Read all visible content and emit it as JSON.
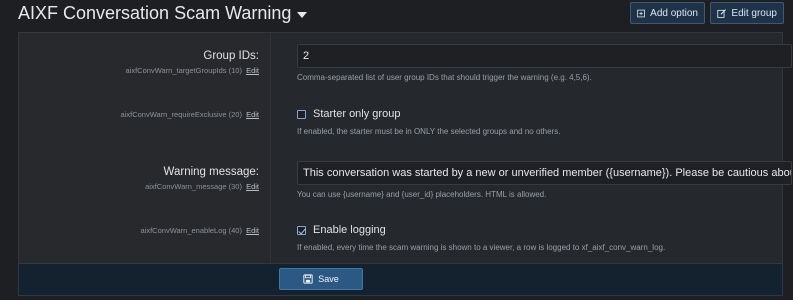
{
  "header": {
    "title": "AIXF Conversation Scam Warning",
    "add_option_label": "Add option",
    "edit_group_label": "Edit group"
  },
  "options": {
    "group_ids": {
      "label": "Group IDs:",
      "id": "aixfConvWarn_targetGroupIds (10)",
      "edit": "Edit",
      "value": "2",
      "explain": "Comma-separated list of user group IDs that should trigger the warning (e.g. 4,5,6)."
    },
    "require_exclusive": {
      "id": "aixfConvWarn_requireExclusive (20)",
      "edit": "Edit",
      "checkbox_label": "Starter only group",
      "checked": false,
      "explain": "If enabled, the starter must be in ONLY the selected groups and no others."
    },
    "message": {
      "label": "Warning message:",
      "id": "aixfConvWarn_message (30)",
      "edit": "Edit",
      "value": "This conversation was started by a new or unverified member ({username}). Please be cautious about sca",
      "explain": "You can use {username} and {user_id} placeholders. HTML is allowed."
    },
    "enable_log": {
      "id": "aixfConvWarn_enableLog (40)",
      "edit": "Edit",
      "checkbox_label": "Enable logging",
      "checked": true,
      "explain": "If enabled, every time the scam warning is shown to a viewer, a row is logged to xf_aixf_conv_warn_log."
    }
  },
  "footer": {
    "save_label": "Save"
  },
  "colors": {
    "background": "#1d1f22",
    "panel": "#25282c",
    "accent": "#2b5984"
  },
  "icons": [
    "caret-down-icon",
    "plus-square-icon",
    "edit-icon",
    "save-icon",
    "checkbox-icon"
  ]
}
